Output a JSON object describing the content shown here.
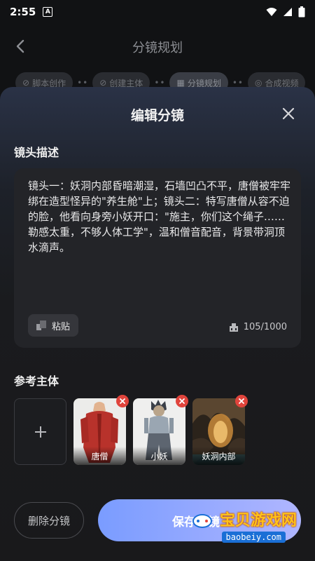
{
  "status_bar": {
    "time": "2:55",
    "notif_letter": "A"
  },
  "header": {
    "title": "分镜规划"
  },
  "steps": [
    {
      "label": "脚本创作"
    },
    {
      "label": "创建主体"
    },
    {
      "label": "分镜规划"
    },
    {
      "label": "合成视频"
    }
  ],
  "sheet": {
    "title": "编辑分镜",
    "desc_label": "镜头描述",
    "description": "镜头一：妖洞内部昏暗潮湿，石墙凹凸不平，唐僧被牢牢绑在造型怪异的\"养生舱\"上；镜头二：特写唐僧从容不迫的脸，他看向身旁小妖开口：\"施主，你们这个绳子……勒感太重，不够人体工学\"，温和僧音配音，背景带洞顶水滴声。",
    "paste_label": "粘贴",
    "char_count": "105/1000",
    "ref_label": "参考主体",
    "refs": [
      {
        "name": "唐僧"
      },
      {
        "name": "小妖"
      },
      {
        "name": "妖洞内部"
      }
    ],
    "delete_label": "删除分镜",
    "save_label": "保存分镜"
  },
  "watermark": {
    "text": "宝贝游戏网",
    "sub": "baobeiy.com"
  },
  "colors": {
    "accent": "#8fa6ff",
    "remove": "#e0443c",
    "watermark": "#ffc21a"
  }
}
